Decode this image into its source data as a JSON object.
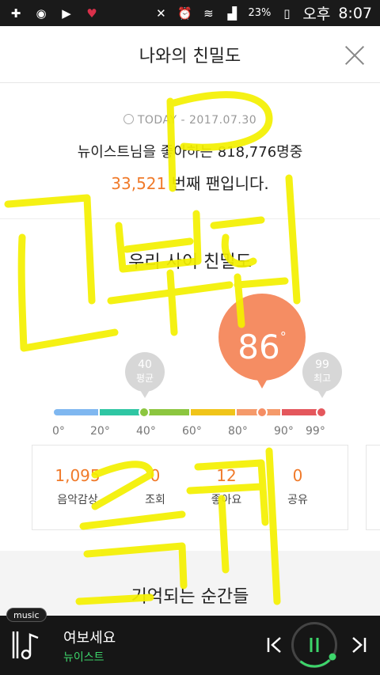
{
  "status_bar": {
    "battery": "23%",
    "ampm": "오후",
    "time": "8:07"
  },
  "header": {
    "title": "나와의 친밀도"
  },
  "rank": {
    "today_label": "TODAY",
    "date": "- 2017.07.30",
    "line1": "뉴이스트님을 좋아하는 818,776명중",
    "rank_number": "33,521",
    "rank_suffix": " 번째 팬입니다."
  },
  "temperature": {
    "section_title": "우리 사이 친밀도",
    "current_value": "86",
    "degree": "°",
    "average": {
      "value": "40",
      "label": "평균"
    },
    "best": {
      "value": "99",
      "label": "최고"
    },
    "ticks": [
      "0°",
      "20°",
      "40°",
      "60°",
      "80°",
      "90°",
      "99°"
    ],
    "colors": {
      "bubble": "#f58d63",
      "pin": "#d7d7d7"
    }
  },
  "stats": [
    {
      "value": "1,095",
      "label": "음악감상"
    },
    {
      "value": "0",
      "label": "조회"
    },
    {
      "value": "12",
      "label": "좋아요"
    },
    {
      "value": "0",
      "label": "공유"
    }
  ],
  "moments": {
    "title": "기억되는 순간들"
  },
  "player": {
    "badge": "music",
    "title": "여보세요",
    "artist": "뉴이스트",
    "accent": "#3dd66b"
  }
}
